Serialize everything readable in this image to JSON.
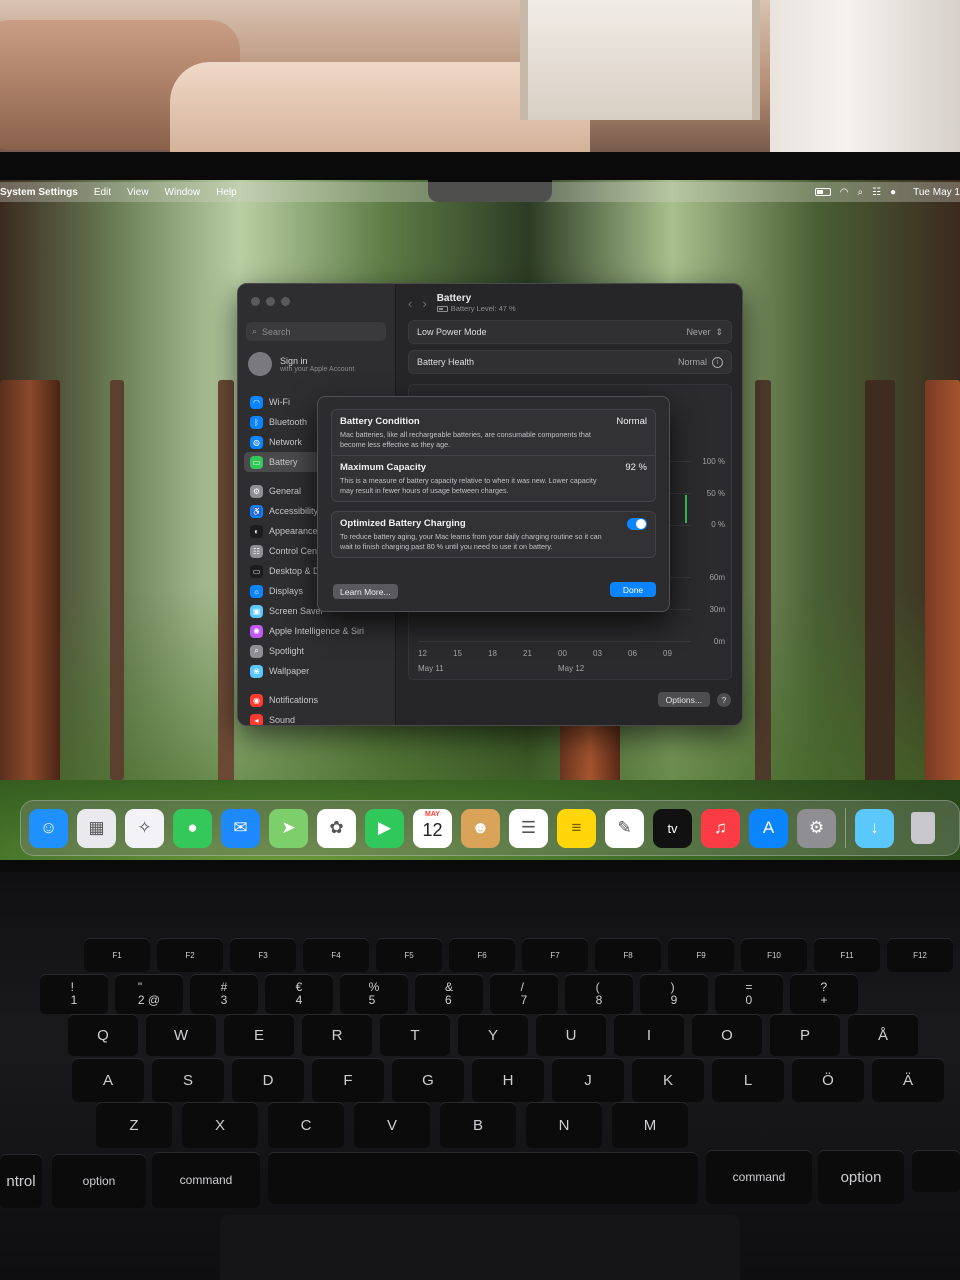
{
  "menubar": {
    "app": "System Settings",
    "items": [
      "Edit",
      "View",
      "Window",
      "Help"
    ],
    "clock": "Tue May 1"
  },
  "sidebar": {
    "search_placeholder": "Search",
    "account_title": "Sign in",
    "account_sub": "with your Apple Account",
    "items": [
      {
        "label": "Wi-Fi",
        "color": "#0a84ff",
        "icon": "wifi-icon"
      },
      {
        "label": "Bluetooth",
        "color": "#0a84ff",
        "icon": "bluetooth-icon"
      },
      {
        "label": "Network",
        "color": "#0a84ff",
        "icon": "globe-icon"
      },
      {
        "label": "Battery",
        "color": "#34c759",
        "icon": "battery-icon"
      },
      {
        "label": "General",
        "color": "#8e8e93",
        "icon": "gear-icon"
      },
      {
        "label": "Accessibility",
        "color": "#0a84ff",
        "icon": "accessibility-icon"
      },
      {
        "label": "Appearance",
        "color": "#1c1c1e",
        "icon": "appearance-icon"
      },
      {
        "label": "Control Centre",
        "color": "#8e8e93",
        "icon": "control-centre-icon"
      },
      {
        "label": "Desktop & Dock",
        "color": "#1c1c1e",
        "icon": "dock-icon"
      },
      {
        "label": "Displays",
        "color": "#0a84ff",
        "icon": "display-icon"
      },
      {
        "label": "Screen Saver",
        "color": "#5ac8fa",
        "icon": "screen-saver-icon"
      },
      {
        "label": "Apple Intelligence & Siri",
        "color": "#bf5af2",
        "icon": "siri-icon"
      },
      {
        "label": "Spotlight",
        "color": "#8e8e93",
        "icon": "search-icon"
      },
      {
        "label": "Wallpaper",
        "color": "#5ac8fa",
        "icon": "wallpaper-icon"
      },
      {
        "label": "Notifications",
        "color": "#ff3b30",
        "icon": "bell-icon"
      },
      {
        "label": "Sound",
        "color": "#ff3b30",
        "icon": "speaker-icon"
      }
    ]
  },
  "battery": {
    "title": "Battery",
    "subtitle": "Battery Level: 47 %",
    "level_percent": 47,
    "rows": [
      {
        "label": "Low Power Mode",
        "value": "Never"
      },
      {
        "label": "Battery Health",
        "value": "Normal"
      }
    ],
    "chart": {
      "y_labels_top": [
        "100 %",
        "50 %",
        "0 %"
      ],
      "y_labels_bottom": [
        "60m",
        "30m",
        "0m"
      ],
      "x_labels": [
        "12",
        "15",
        "18",
        "21",
        "00",
        "03",
        "06",
        "09"
      ],
      "date_labels": [
        "May 11",
        "May 12"
      ]
    },
    "options_label": "Options...",
    "help_label": "?"
  },
  "sheet": {
    "condition_title": "Battery Condition",
    "condition_value": "Normal",
    "condition_desc": "Mac batteries, like all rechargeable batteries, are consumable components that become less effective as they age.",
    "capacity_title": "Maximum Capacity",
    "capacity_value": "92 %",
    "capacity_desc": "This is a measure of battery capacity relative to when it was new. Lower capacity may result in fewer hours of usage between charges.",
    "optimized_title": "Optimized Battery Charging",
    "optimized_desc": "To reduce battery aging, your Mac learns from your daily charging routine so it can wait to finish charging past 80 % until you need to use it on battery.",
    "optimized_on": true,
    "learn_more": "Learn More...",
    "done": "Done"
  },
  "dock": {
    "apps": [
      {
        "name": "finder",
        "bg": "#1e90ff",
        "glyph": "☺"
      },
      {
        "name": "launchpad",
        "bg": "#e9e9ee",
        "glyph": "▦"
      },
      {
        "name": "safari",
        "bg": "#f2f2f7",
        "glyph": "✧"
      },
      {
        "name": "messages",
        "bg": "#34c759",
        "glyph": "●"
      },
      {
        "name": "mail",
        "bg": "#1e88ff",
        "glyph": "✉"
      },
      {
        "name": "maps",
        "bg": "#7ccf6b",
        "glyph": "➤"
      },
      {
        "name": "photos",
        "bg": "#ffffff",
        "glyph": "✿"
      },
      {
        "name": "facetime",
        "bg": "#30c85a",
        "glyph": "▶"
      },
      {
        "name": "calendar",
        "bg": "#ffffff",
        "glyph": ""
      },
      {
        "name": "contacts",
        "bg": "#d9a35a",
        "glyph": "☻"
      },
      {
        "name": "reminders",
        "bg": "#ffffff",
        "glyph": "☰"
      },
      {
        "name": "notes",
        "bg": "#ffd60a",
        "glyph": "≡"
      },
      {
        "name": "freeform",
        "bg": "#ffffff",
        "glyph": "✎"
      },
      {
        "name": "tv",
        "bg": "#111111",
        "glyph": "tv"
      },
      {
        "name": "music",
        "bg": "#fc3c44",
        "glyph": "♫"
      },
      {
        "name": "app-store",
        "bg": "#0a84ff",
        "glyph": "A"
      },
      {
        "name": "system-settings",
        "bg": "#8e8e93",
        "glyph": "⚙"
      }
    ],
    "calendar_month": "MAY",
    "calendar_day": "12",
    "downloads": {
      "bg": "#5ac8fa",
      "glyph": "↓"
    },
    "trash": {
      "bg": "#c7c7cc",
      "glyph": "🗑"
    }
  },
  "keyboard": {
    "fn_row": [
      "F1",
      "F2",
      "F3",
      "F4",
      "F5",
      "F6",
      "F7",
      "F8",
      "F9",
      "F10",
      "F11",
      "F12"
    ],
    "num_row": [
      "!\n1",
      "\"\n2 @",
      "#\n3",
      "€\n4",
      "%\n5",
      "&\n6",
      "/\n7",
      "(\n8",
      ")\n9",
      "=\n0",
      "?\n+"
    ],
    "row_q": [
      "Q",
      "W",
      "E",
      "R",
      "T",
      "Y",
      "U",
      "I",
      "O",
      "P",
      "Å"
    ],
    "row_a": [
      "A",
      "S",
      "D",
      "F",
      "G",
      "H",
      "J",
      "K",
      "L",
      "Ö",
      "Ä"
    ],
    "row_z": [
      "Z",
      "X",
      "C",
      "V",
      "B",
      "N",
      "M"
    ],
    "mods": {
      "control": "ntrol",
      "option_l": "option",
      "command_l": "command",
      "command_r": "command",
      "option_r": "option"
    }
  }
}
